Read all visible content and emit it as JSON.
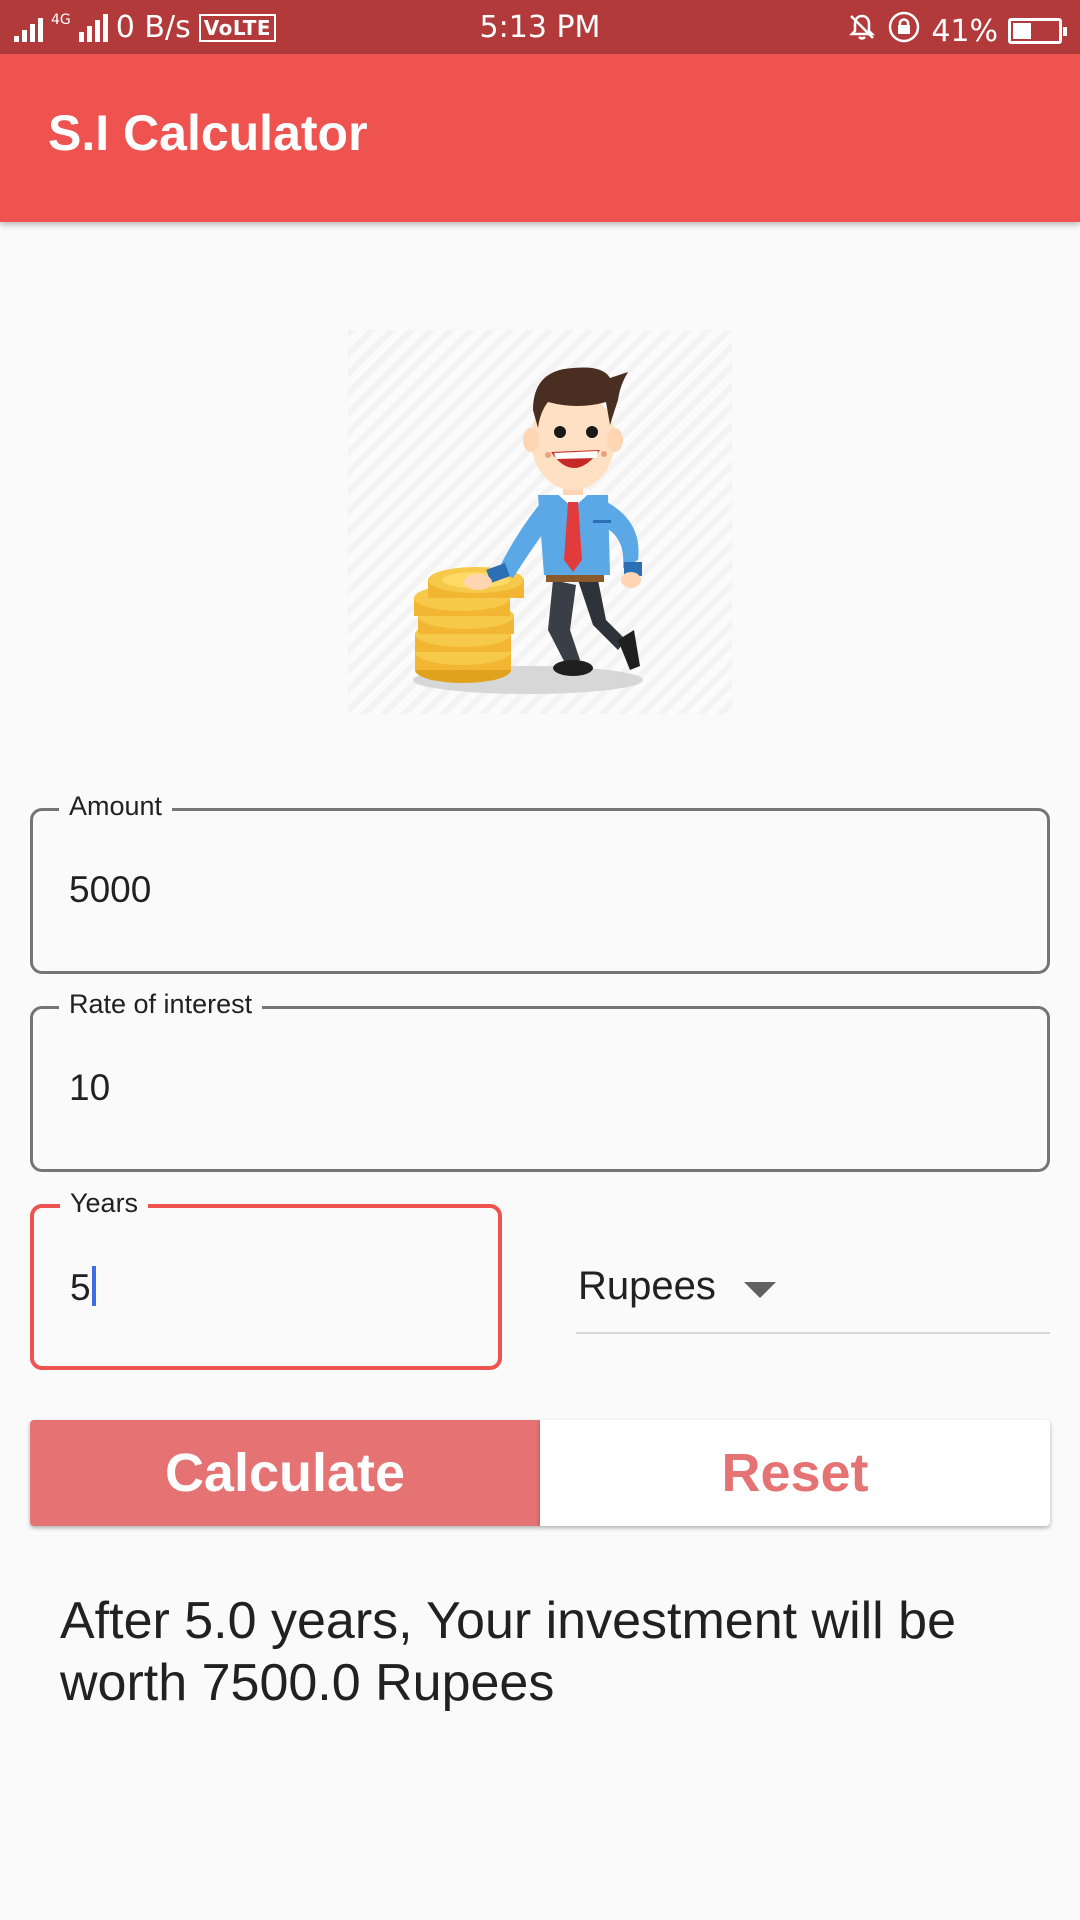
{
  "status_bar": {
    "network_type": "4G",
    "data_speed": "0 B/s",
    "volte": "VoLTE",
    "time": "5:13 PM",
    "battery_percent": "41%",
    "battery_level": 0.41
  },
  "app_bar": {
    "title": "S.I Calculator",
    "color": "#ef5350"
  },
  "form": {
    "amount": {
      "label": "Amount",
      "value": "5000"
    },
    "rate": {
      "label": "Rate of interest",
      "value": "10"
    },
    "years": {
      "label": "Years",
      "value": "5"
    },
    "currency": {
      "selected": "Rupees"
    }
  },
  "buttons": {
    "calculate_label": "Calculate",
    "reset_label": "Reset"
  },
  "result": {
    "text": "After 5.0 years, Your investment will be worth 7500.0 Rupees"
  },
  "icons": [
    "signal-icon",
    "mute-icon",
    "lock-rotation-icon",
    "battery-icon",
    "dropdown-arrow-icon"
  ],
  "colors": {
    "status_bar": "#b23a3a",
    "accent": "#ef5350",
    "button_fill": "#e57373",
    "caret": "#3b6fe6"
  }
}
